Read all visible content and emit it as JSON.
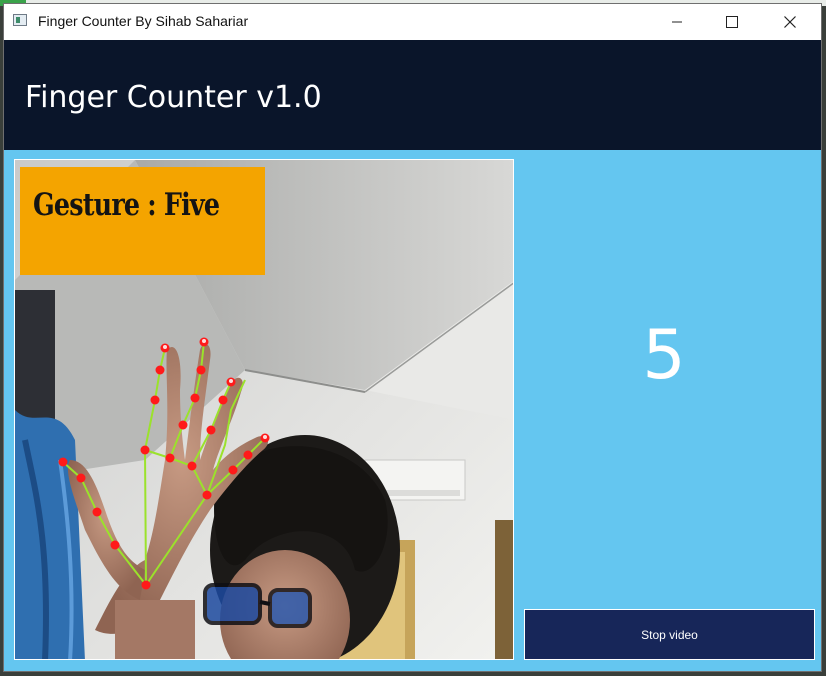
{
  "window": {
    "title": "Finger Counter By Sihab Sahariar",
    "controls": [
      "minimize-icon",
      "maximize-icon",
      "close-icon"
    ]
  },
  "header": {
    "title": "Finger Counter v1.0"
  },
  "video": {
    "gesture_label": "Gesture : Five"
  },
  "counter": {
    "value": "5"
  },
  "controls": {
    "stop_label": "Stop video"
  },
  "colors": {
    "header_bg": "#0a152a",
    "panel_bg": "#64c6f0",
    "button_bg": "#172659",
    "gesture_bg": "#f4a400",
    "landmark": "#ff1a1a",
    "connector": "#9be22b"
  }
}
